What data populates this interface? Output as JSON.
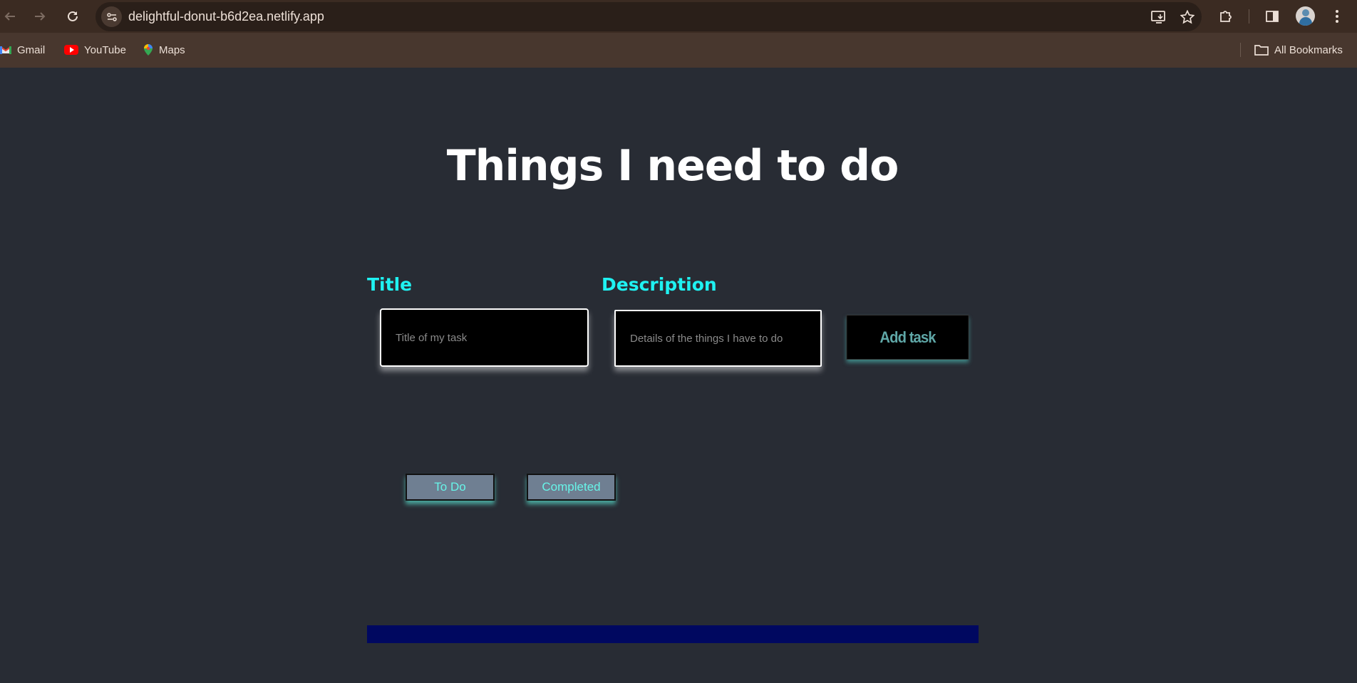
{
  "browser": {
    "url": "delightful-donut-b6d2ea.netlify.app",
    "bookmarks": [
      {
        "label": "Gmail",
        "icon": "gmail-icon"
      },
      {
        "label": "YouTube",
        "icon": "youtube-icon"
      },
      {
        "label": "Maps",
        "icon": "maps-icon"
      }
    ],
    "all_bookmarks_label": "All Bookmarks"
  },
  "app": {
    "heading": "Things I need to do",
    "title_label": "Title",
    "title_placeholder": "Title of my task",
    "description_label": "Description",
    "description_placeholder": "Details of the things I have to do",
    "add_button_label": "Add task",
    "tabs": [
      {
        "label": "To Do"
      },
      {
        "label": "Completed"
      }
    ]
  },
  "colors": {
    "background": "#282c34",
    "accent_cyan": "#1ff2f2",
    "list_bar": "#000860"
  }
}
